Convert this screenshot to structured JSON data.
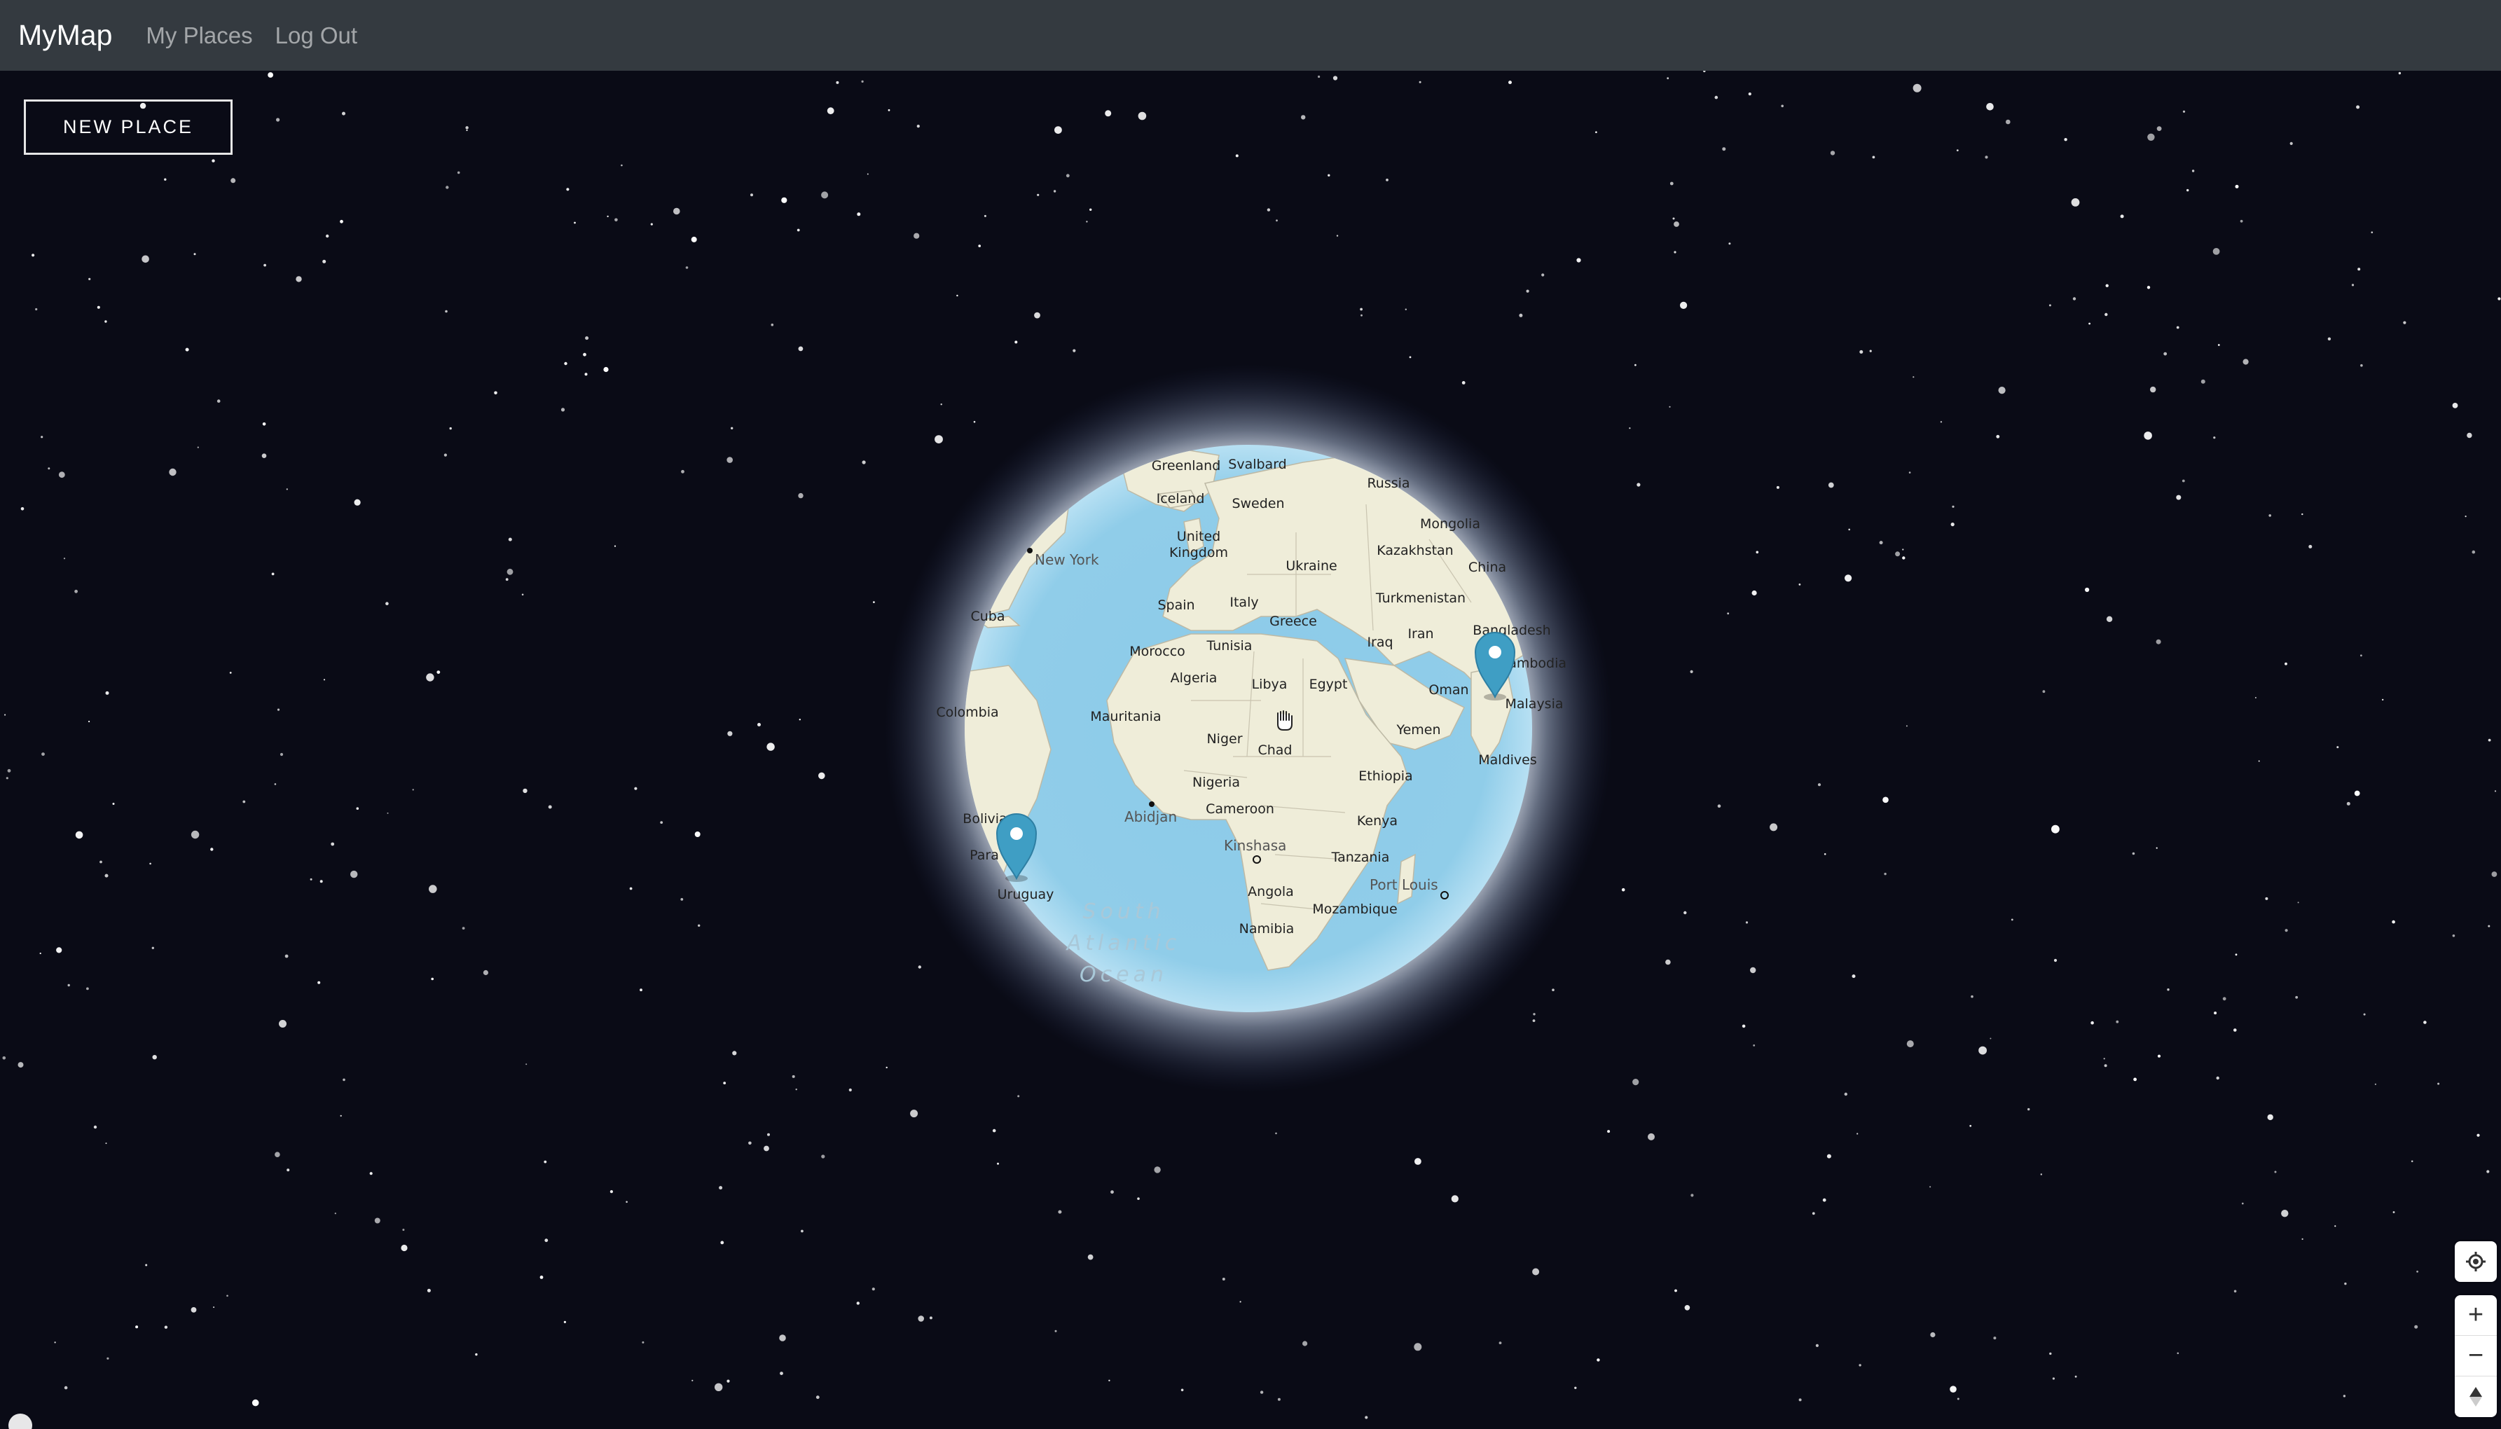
{
  "navbar": {
    "brand": "MyMap",
    "links": [
      "My Places",
      "Log Out"
    ]
  },
  "toolbar": {
    "new_place_label": "NEW PLACE"
  },
  "map": {
    "countries": {
      "greenland": "Greenland",
      "svalbard": "Svalbard",
      "russia": "Russia",
      "iceland": "Iceland",
      "sweden": "Sweden",
      "mongolia": "Mongolia",
      "united_kingdom_1": "United",
      "united_kingdom_2": "Kingdom",
      "kazakhstan": "Kazakhstan",
      "ukraine": "Ukraine",
      "china": "China",
      "turkmenistan": "Turkmenistan",
      "cuba": "Cuba",
      "spain": "Spain",
      "italy": "Italy",
      "greece": "Greece",
      "bangladesh": "Bangladesh",
      "cambodia": "Cambodia",
      "iraq": "Iraq",
      "iran": "Iran",
      "morocco": "Morocco",
      "tunisia": "Tunisia",
      "algeria": "Algeria",
      "libya": "Libya",
      "egypt": "Egypt",
      "oman": "Oman",
      "malaysia": "Malaysia",
      "colombia": "Colombia",
      "mauritania": "Mauritania",
      "niger": "Niger",
      "chad": "Chad",
      "yemen": "Yemen",
      "maldives": "Maldives",
      "nigeria": "Nigeria",
      "ethiopia": "Ethiopia",
      "bolivia": "Bolivia",
      "cameroon": "Cameroon",
      "kenya": "Kenya",
      "paraguay": "Para",
      "tanzania": "Tanzania",
      "uruguay": "Uruguay",
      "angola": "Angola",
      "mozambique": "Mozambique",
      "namibia": "Namibia"
    },
    "cities": {
      "new_york": "New York",
      "abidjan": "Abidjan",
      "kinshasa": "Kinshasa",
      "port_louis": "Port Louis"
    },
    "ocean": {
      "line1": "South",
      "line2": "Atlantic",
      "line3": "Ocean"
    },
    "markers": [
      {
        "name": "marker-uruguay",
        "label": ""
      },
      {
        "name": "marker-cambodia",
        "label": ""
      }
    ],
    "colors": {
      "water": "#8fcbe8",
      "land": "#efedd9",
      "marker": "#3f9ec4",
      "space": "#0a0b16"
    }
  },
  "controls": {
    "locate_icon": "target-icon",
    "zoom_in": "+",
    "zoom_out": "−",
    "compass_icon": "compass-icon"
  }
}
